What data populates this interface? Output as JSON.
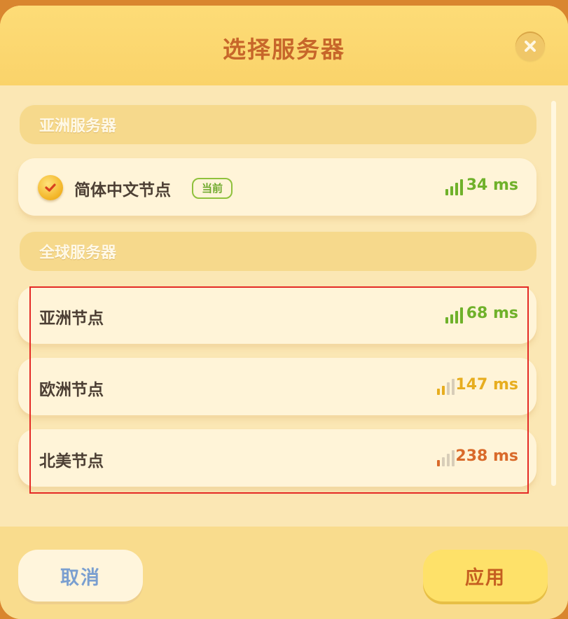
{
  "dialog": {
    "title": "选择服务器",
    "close_icon": "close-icon"
  },
  "sections": [
    {
      "label": "亚洲服务器"
    },
    {
      "label": "全球服务器"
    }
  ],
  "current_server": {
    "name": "简体中文节点",
    "badge": "当前",
    "ping": "34 ms",
    "signal_bars_active": 4,
    "color": "#6fb12a",
    "selected": true
  },
  "servers": [
    {
      "name": "亚洲节点",
      "ping": "68 ms",
      "signal_bars_active": 4,
      "color": "#6fb12a"
    },
    {
      "name": "欧洲节点",
      "ping": "147 ms",
      "signal_bars_active": 2,
      "color": "#e7ad1f"
    },
    {
      "name": "北美节点",
      "ping": "238 ms",
      "signal_bars_active": 1,
      "color": "#d96a2a"
    }
  ],
  "footer": {
    "cancel_label": "取消",
    "apply_label": "应用"
  }
}
